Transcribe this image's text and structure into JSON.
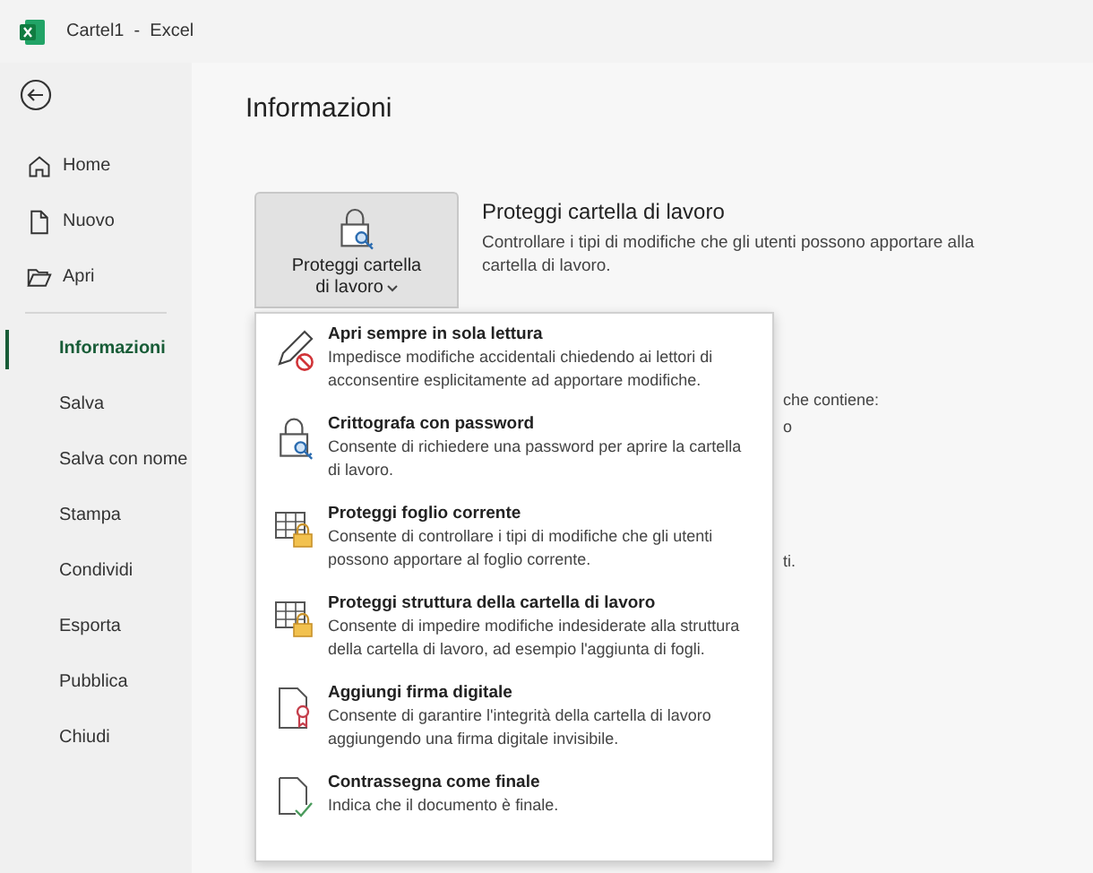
{
  "window": {
    "title": "Cartel1  -  Excel"
  },
  "sidebar": {
    "items": [
      {
        "label": "Home",
        "kind": "home",
        "selected": false
      },
      {
        "label": "Nuovo",
        "kind": "file",
        "selected": false
      },
      {
        "label": "Apri",
        "kind": "folder",
        "selected": false
      },
      {
        "label": "Informazioni",
        "selected": true
      },
      {
        "label": "Salva",
        "selected": false
      },
      {
        "label": "Salva con nome",
        "selected": false
      },
      {
        "label": "Stampa",
        "selected": false
      },
      {
        "label": "Condividi",
        "selected": false
      },
      {
        "label": "Esporta",
        "selected": false
      },
      {
        "label": "Pubblica",
        "selected": false
      },
      {
        "label": "Chiudi",
        "selected": false
      }
    ]
  },
  "page_title": "Informazioni",
  "protect_button": {
    "line1": "Proteggi cartella",
    "line2": "di lavoro",
    "expanded": true
  },
  "protect_section": {
    "title": "Proteggi cartella di lavoro",
    "description": "Controllare i tipi di modifiche che gli utenti possono apportare alla cartella di lavoro."
  },
  "background_fragments": [
    "che contiene:",
    "o",
    "ti."
  ],
  "menu": [
    {
      "kind": "readonly",
      "title": "Apri sempre in sola lettura",
      "description": "Impedisce modifiche accidentali chiedendo ai lettori di acconsentire esplicitamente ad apportare modifiche."
    },
    {
      "kind": "encrypt",
      "title": "Crittografa con password",
      "description": "Consente di richiedere una password per aprire la cartella di lavoro."
    },
    {
      "kind": "sheet",
      "title": "Proteggi foglio corrente",
      "description": "Consente di controllare i tipi di modifiche che gli utenti possono apportare al foglio corrente."
    },
    {
      "kind": "structure",
      "title": "Proteggi struttura della cartella di lavoro",
      "description": "Consente di impedire modifiche indesiderate alla struttura della cartella di lavoro, ad esempio l'aggiunta di fogli."
    },
    {
      "kind": "signature",
      "title": "Aggiungi firma digitale",
      "description": "Consente di garantire l'integrità della cartella di lavoro aggiungendo una firma digitale invisibile."
    },
    {
      "kind": "final",
      "title": "Contrassegna come finale",
      "description": "Indica che il documento è finale."
    }
  ]
}
